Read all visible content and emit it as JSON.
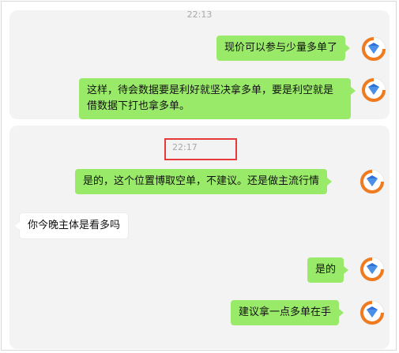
{
  "chat": {
    "top": {
      "timestamp": "22:13",
      "messages": [
        {
          "text": "现价可以参与少量多单了"
        },
        {
          "text": "这样，待会数据要是利好就坚决拿多单，要是利空就是借数据下打也拿多单。"
        }
      ]
    },
    "bottom": {
      "timestamp": "22:17",
      "messages": [
        {
          "text": "是的，这个位置博取空单，不建议。还是做主流行情"
        },
        {
          "text": "你今晚主体是看多吗"
        },
        {
          "text": "是的"
        },
        {
          "text": "建议拿一点多单在手"
        }
      ]
    }
  },
  "colors": {
    "sent_bubble": "#9aea6a",
    "received_bubble": "#ffffff",
    "highlight": "#e83a3a",
    "panel_bg": "#f3f3f3"
  },
  "icons": {
    "avatar": "orange-ring-blue-diamond-logo"
  }
}
